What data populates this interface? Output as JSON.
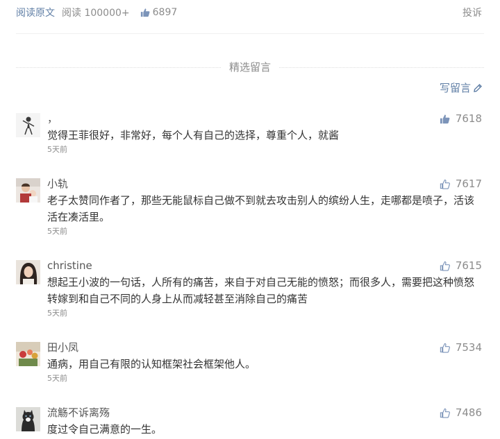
{
  "topbar": {
    "read_original": "阅读原文",
    "read_count": "阅读 100000+",
    "likes": "6897",
    "report": "投诉"
  },
  "section": {
    "title": "精选留言",
    "write_comment": "写留言"
  },
  "colors": {
    "link": "#607fa6",
    "meta": "#8c8c8c",
    "text": "#333333"
  },
  "comments": [
    {
      "nickname": "，",
      "content": "觉得王菲很好，非常好，每个人有自己的选择，尊重个人，就酱",
      "time": "5天前",
      "likes": "7618",
      "liked": true,
      "avatar_icon": "avatar-woman-dancing"
    },
    {
      "nickname": "小轨",
      "content": "老子太赞同作者了，那些无能鼠标自己做不到就去攻击别人的缤纷人生，走哪都是喷子，活该活在凑活里。",
      "time": "5天前",
      "likes": "7617",
      "liked": false,
      "avatar_icon": "avatar-person-with-baby"
    },
    {
      "nickname": "christine",
      "content": "想起王小波的一句话，人所有的痛苦，来自于对自己无能的愤怒；而很多人，需要把这种愤怒转嫁到和自己不同的人身上从而减轻甚至消除自己的痛苦",
      "time": "5天前",
      "likes": "7615",
      "liked": false,
      "avatar_icon": "avatar-woman-portrait"
    },
    {
      "nickname": "田小凤",
      "content": "通病，用自己有限的认知框架社会框架他人。",
      "time": "5天前",
      "likes": "7534",
      "liked": false,
      "avatar_icon": "avatar-flowers"
    },
    {
      "nickname": "流觞不诉离殇",
      "content": "度过令自己满意的一生。",
      "time": "",
      "likes": "7486",
      "liked": false,
      "avatar_icon": "avatar-cat"
    }
  ]
}
